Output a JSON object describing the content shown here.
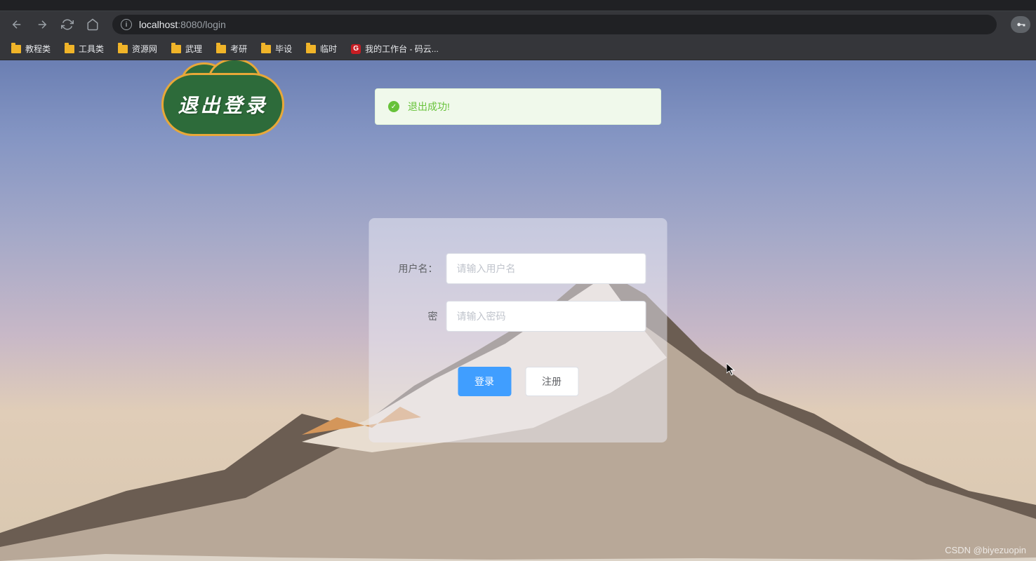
{
  "browser": {
    "url_host": "localhost",
    "url_port": ":8080",
    "url_path": "/login"
  },
  "bookmarks": [
    {
      "label": "教程类",
      "icon": "folder"
    },
    {
      "label": "工具类",
      "icon": "folder"
    },
    {
      "label": "资源网",
      "icon": "folder"
    },
    {
      "label": "武理",
      "icon": "folder"
    },
    {
      "label": "考研",
      "icon": "folder"
    },
    {
      "label": "毕设",
      "icon": "folder"
    },
    {
      "label": "临时",
      "icon": "folder"
    },
    {
      "label": "我的工作台 - 码云...",
      "icon": "gitee"
    }
  ],
  "logout_badge": "退出登录",
  "toast": {
    "message": "退出成功!"
  },
  "login": {
    "username_label": "用户名：",
    "username_placeholder": "请输入用户名",
    "password_label": "密",
    "password_placeholder": "请输入密码",
    "login_btn": "登录",
    "register_btn": "注册"
  },
  "watermark": "CSDN @biyezuopin"
}
